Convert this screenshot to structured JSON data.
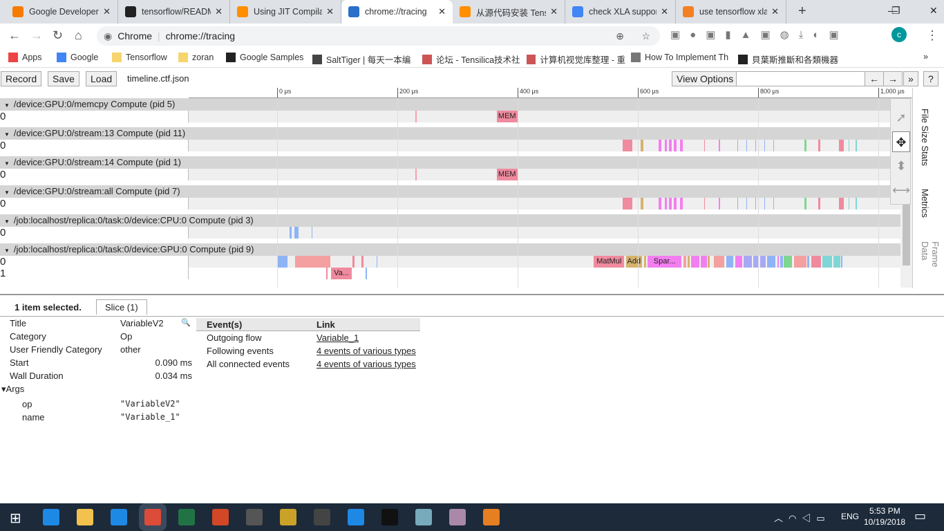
{
  "browser": {
    "tabs": [
      {
        "title": "Google Developer",
        "color": "#f57c00"
      },
      {
        "title": "tensorflow/README",
        "color": "#222"
      },
      {
        "title": "Using JIT Compilat",
        "color": "#ff8f00"
      },
      {
        "title": "chrome://tracing",
        "color": "#2a6fc9",
        "active": true
      },
      {
        "title": "从源代码安装 Tens",
        "color": "#ff8f00"
      },
      {
        "title": "check XLA support",
        "color": "#4285f4"
      },
      {
        "title": "use tensorflow xla",
        "color": "#f48024"
      }
    ],
    "new_tab": "+",
    "omnibox": {
      "site": "Chrome",
      "url": "chrome://tracing"
    },
    "profile": "c",
    "bookmarks": [
      "Apps",
      "Google",
      "Tensorflow",
      "zoran",
      "Google Samples",
      "SaltTiger | 每天一本编",
      "论坛 - Tensilica技术社",
      "计算机视觉库整理 - 重",
      "How To Implement Th",
      "貝葉斯推斷和各類機器"
    ],
    "more_bookmarks": "»"
  },
  "toolbar": {
    "record": "Record",
    "save": "Save",
    "load": "Load",
    "filename": "timeline.ctf.json",
    "view_options": "View Options",
    "prev": "←",
    "next": "→",
    "expand": "»",
    "help": "?"
  },
  "ruler": {
    "ticks": [
      "0 μs",
      "200 μs",
      "400 μs",
      "600 μs",
      "800 μs",
      "1,000 μs"
    ],
    "ticks_us": [
      0,
      200,
      400,
      600,
      800,
      1000
    ]
  },
  "groups": [
    {
      "title": "/device:GPU:0/memcpy Compute (pid 5)",
      "rows": [
        {
          "label": "0",
          "events": [
            {
              "s": 230,
              "d": 1,
              "c": "#f4a0b0"
            },
            {
              "s": 365,
              "d": 35,
              "c": "#f08a9e",
              "n": "MEM"
            }
          ]
        }
      ]
    },
    {
      "title": "/device:GPU:0/stream:13 Compute (pid 11)",
      "rows": [
        {
          "label": "0",
          "events": "stream"
        }
      ]
    },
    {
      "title": "/device:GPU:0/stream:14 Compute (pid 1)",
      "rows": [
        {
          "label": "0",
          "events": [
            {
              "s": 230,
              "d": 1,
              "c": "#f4a0b0"
            },
            {
              "s": 365,
              "d": 35,
              "c": "#f08a9e",
              "n": "MEM"
            }
          ]
        }
      ]
    },
    {
      "title": "/device:GPU:0/stream:all Compute (pid 7)",
      "rows": [
        {
          "label": "0",
          "events": "stream"
        }
      ]
    },
    {
      "title": "/job:localhost/replica:0/task:0/device:CPU:0 Compute (pid 3)",
      "rows": [
        {
          "label": "0",
          "events": [
            {
              "s": 21,
              "d": 3,
              "c": "#8fb4f5"
            },
            {
              "s": 29,
              "d": 7,
              "c": "#8fb4f5"
            },
            {
              "s": 57,
              "d": 2,
              "c": "#8fb4f5"
            }
          ]
        }
      ]
    },
    {
      "title": "/job:localhost/replica:0/task:0/device:GPU:0 Compute (pid 9)",
      "rows": [
        {
          "label": "0",
          "events": "gpu"
        },
        {
          "label": "1",
          "events": [
            {
              "s": 82,
              "d": 2,
              "c": "#f08a9e"
            },
            {
              "s": 90,
              "d": 34,
              "c": "#f08a9e",
              "n": "Va..."
            },
            {
              "s": 147,
              "d": 2,
              "c": "#8fb4f5"
            }
          ]
        }
      ]
    }
  ],
  "side_tabs": [
    "File Size Stats",
    "Metrics",
    "Frame Data"
  ],
  "details": {
    "selected": "1 item selected.",
    "tab": "Slice (1)",
    "fields": [
      [
        "Title",
        "VariableV2"
      ],
      [
        "Category",
        "Op"
      ],
      [
        "User Friendly Category",
        "other"
      ],
      [
        "Start",
        "0.090 ms"
      ],
      [
        "Wall Duration",
        "0.034 ms"
      ]
    ],
    "args_label": "▾Args",
    "args": [
      [
        "op",
        "\"VariableV2\""
      ],
      [
        "name",
        "\"Variable_1\""
      ]
    ],
    "events_header": [
      "Event(s)",
      "Link"
    ],
    "events": [
      [
        "Outgoing flow",
        "Variable_1"
      ],
      [
        "Following events",
        "4 events of various types"
      ],
      [
        "All connected events",
        "4 events of various types"
      ]
    ]
  },
  "taskbar": {
    "lang": "ENG",
    "time": "5:53 PM",
    "date": "10/19/2018"
  }
}
